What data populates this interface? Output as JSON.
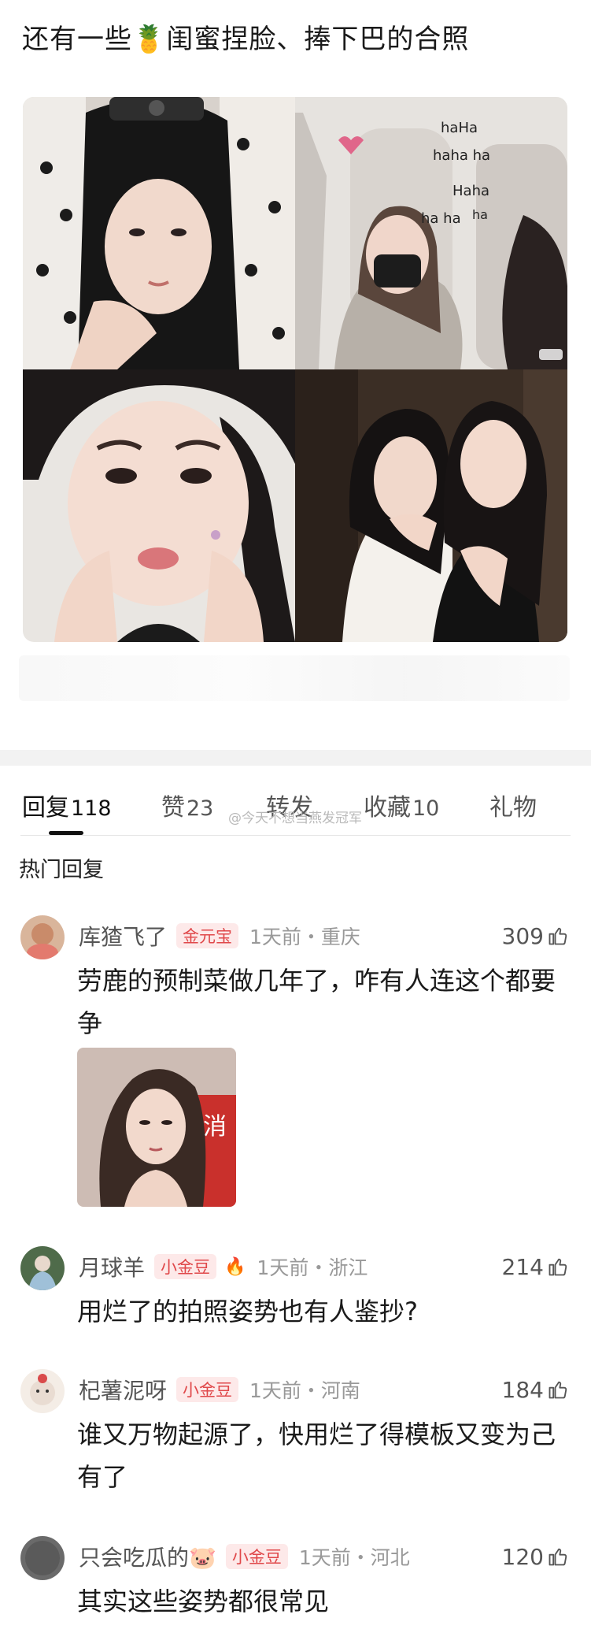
{
  "post": {
    "title_before": "还有一些",
    "title_emoji": "🍍",
    "title_after": "闺蜜捏脸、捧下巴的合照",
    "photo_annotation": [
      "haHa",
      "haha ha",
      "Haha",
      "ha ha",
      "ha"
    ]
  },
  "tabs": [
    {
      "label": "回复",
      "count": "118",
      "active": true
    },
    {
      "label": "赞",
      "count": "23",
      "active": false
    },
    {
      "label": "转发",
      "count": "",
      "active": false
    },
    {
      "label": "收藏",
      "count": "10",
      "active": false
    },
    {
      "label": "礼物",
      "count": "",
      "active": false
    }
  ],
  "watermark": "@今天不想当燕发冠军",
  "section_title": "热门回复",
  "comments": [
    {
      "username": "库猹飞了",
      "badge": "金元宝",
      "badge_icon": "",
      "time": "1天前・重庆",
      "likes": "309",
      "text": "劳鹿的预制菜做几年了，咋有人连这个都要争",
      "has_image": true,
      "image_sign": "消",
      "avatar_color": "#c98b6a"
    },
    {
      "username": "月球羊",
      "badge": "小金豆",
      "badge_icon": "🔥",
      "time": "1天前・浙江",
      "likes": "214",
      "text": "用烂了的拍照姿势也有人鉴抄?",
      "has_image": false,
      "avatar_color": "#7aa0b8"
    },
    {
      "username": "杞薯泥呀",
      "badge": "小金豆",
      "badge_icon": "",
      "time": "1天前・河南",
      "likes": "184",
      "text": "谁又万物起源了，快用烂了得模板又变为己有了",
      "has_image": false,
      "avatar_color": "#e9dcd2"
    },
    {
      "username": "只会吃瓜的🐷",
      "badge": "小金豆",
      "badge_icon": "",
      "time": "1天前・河北",
      "likes": "120",
      "text": "其实这些姿势都很常见",
      "has_image": false,
      "avatar_color": "#6a6a6a"
    }
  ],
  "colors": {
    "badge_text": "#e0484a",
    "badge_bg": "#fde9e9",
    "meta_gray": "#999999",
    "band_gray": "#f2f2f2"
  },
  "icons": {
    "like": "thumbs-up-icon"
  }
}
